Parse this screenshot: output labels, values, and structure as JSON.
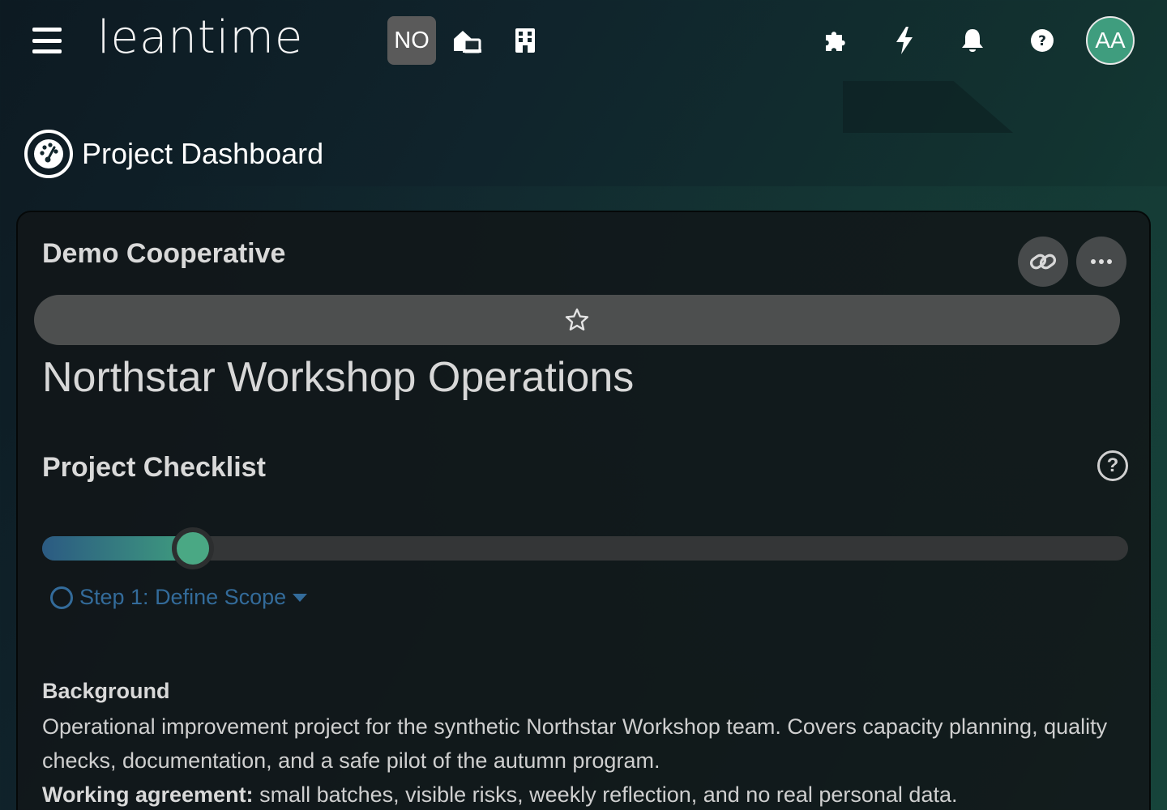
{
  "header": {
    "logo_text": "leantime",
    "project_badge": "NO",
    "avatar_initials": "AA",
    "icons": [
      "menu-icon",
      "home-switch-icon",
      "building-icon",
      "puzzle-icon",
      "bolt-icon",
      "bell-icon",
      "help-icon"
    ]
  },
  "page": {
    "title": "Project Dashboard"
  },
  "project": {
    "client_name": "Demo Cooperative",
    "name": "Northstar Workshop Operations"
  },
  "checklist": {
    "title": "Project Checklist",
    "progress_fraction": 0.124,
    "current_step": "Step 1: Define Scope"
  },
  "background": {
    "heading": "Background",
    "text": "Operational improvement project for the synthetic Northstar Workshop team. Covers capacity planning, quality checks, documentation, and a safe pilot of the autumn program.",
    "agreement_label": "Working agreement:",
    "agreement_text": " small batches, visible risks, weekly reflection, and no real personal data."
  },
  "colors": {
    "accent": "#3f9d7e",
    "step_blue": "#336b9a",
    "card_bg": "#111618"
  }
}
